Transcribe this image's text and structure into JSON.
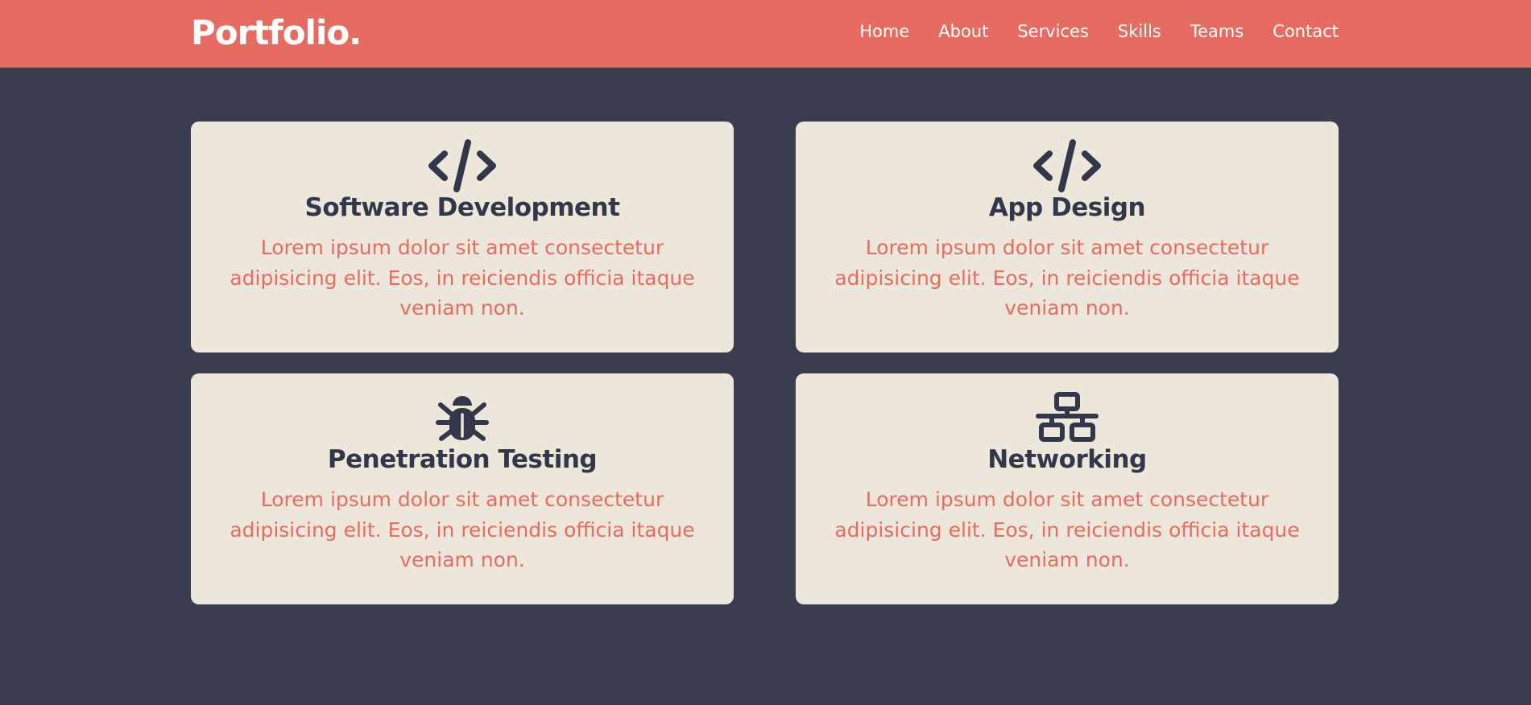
{
  "header": {
    "brand": "Portfolio.",
    "nav": [
      "Home",
      "About",
      "Services",
      "Skills",
      "Teams",
      "Contact"
    ]
  },
  "services": [
    {
      "icon": "code-icon",
      "title": "Software Development",
      "text": "Lorem ipsum dolor sit amet consectetur adipisicing elit. Eos, in reiciendis officia itaque veniam non."
    },
    {
      "icon": "code-icon",
      "title": "App Design",
      "text": "Lorem ipsum dolor sit amet consectetur adipisicing elit. Eos, in reiciendis officia itaque veniam non."
    },
    {
      "icon": "bug-icon",
      "title": "Penetration Testing",
      "text": "Lorem ipsum dolor sit amet consectetur adipisicing elit. Eos, in reiciendis officia itaque veniam non."
    },
    {
      "icon": "network-icon",
      "title": "Networking",
      "text": "Lorem ipsum dolor sit amet consectetur adipisicing elit. Eos, in reiciendis officia itaque veniam non."
    }
  ],
  "colors": {
    "accent": "#e66c61",
    "background": "#3a3d50",
    "card": "#ede6da",
    "heading": "#32374a"
  }
}
